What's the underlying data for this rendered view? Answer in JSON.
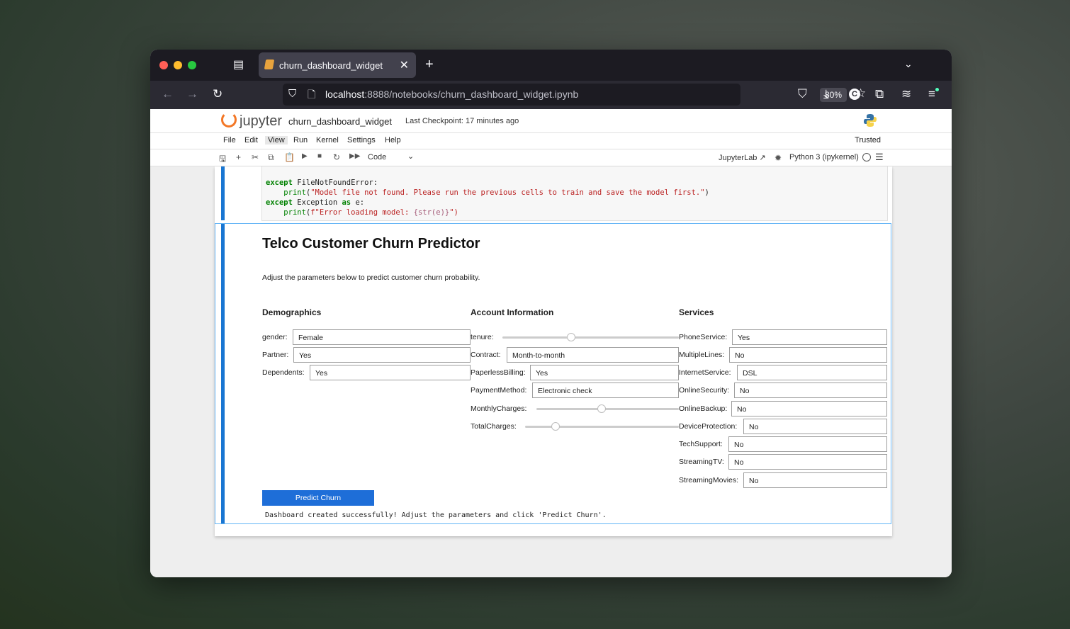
{
  "browser": {
    "tab_title": "churn_dashboard_widget",
    "url_host": "localhost",
    "url_rest": ":8888/notebooks/churn_dashboard_widget.ipynb",
    "zoom": "80%"
  },
  "jupyter": {
    "logo_text": "jupyter",
    "notebook_name": "churn_dashboard_widget",
    "checkpoint": "Last Checkpoint: 17 minutes ago",
    "menu": [
      "File",
      "Edit",
      "View",
      "Run",
      "Kernel",
      "Settings",
      "Help"
    ],
    "trusted": "Trusted",
    "cell_type": "Code",
    "jupyterlab_link": "JupyterLab",
    "kernel": "Python 3 (ipykernel)"
  },
  "code_lines": {
    "l1_kw": "except",
    "l1_rest": " FileNotFoundError:",
    "l2_fn": "print",
    "l2_str": "\"Model file not found. Please run the previous cells to train and save the model first.\"",
    "l3_kw": "except",
    "l3_mid": " Exception ",
    "l3_as": "as",
    "l3_rest": " e:",
    "l4_fn": "print",
    "l4_str": "f\"Error loading model: ",
    "l4_expr": "{str(e)}",
    "l4_end": "\")"
  },
  "dashboard": {
    "title": "Telco Customer Churn Predictor",
    "description": "Adjust the parameters below to predict customer churn probability.",
    "sections": {
      "demographics": "Demographics",
      "account": "Account Information",
      "services": "Services"
    },
    "demographics": {
      "gender": {
        "label": "gender:",
        "value": "Female"
      },
      "partner": {
        "label": "Partner:",
        "value": "Yes"
      },
      "dependents": {
        "label": "Dependents:",
        "value": "Yes"
      }
    },
    "account": {
      "tenure": {
        "label": "tenure:",
        "position": 0.39
      },
      "contract": {
        "label": "Contract:",
        "value": "Month-to-month"
      },
      "paperless": {
        "label": "PaperlessBilling:",
        "value": "Yes"
      },
      "payment": {
        "label": "PaymentMethod:",
        "value": "Electronic check"
      },
      "monthly": {
        "label": "MonthlyCharges:",
        "position": 0.46
      },
      "total": {
        "label": "TotalCharges:",
        "position": 0.2
      }
    },
    "services": {
      "phone": {
        "label": "PhoneService:",
        "value": "Yes"
      },
      "multiple": {
        "label": "MultipleLines:",
        "value": "No"
      },
      "internet": {
        "label": "InternetService:",
        "value": "DSL"
      },
      "security": {
        "label": "OnlineSecurity:",
        "value": "No"
      },
      "backup": {
        "label": "OnlineBackup:",
        "value": "No"
      },
      "protection": {
        "label": "DeviceProtection:",
        "value": "No"
      },
      "techsupport": {
        "label": "TechSupport:",
        "value": "No"
      },
      "tv": {
        "label": "StreamingTV:",
        "value": "No"
      },
      "movies": {
        "label": "StreamingMovies:",
        "value": "No"
      }
    },
    "predict_button": "Predict Churn",
    "output": "Dashboard created successfully! Adjust the parameters and click 'Predict Churn'."
  },
  "colors": {
    "accent": "#1e6ed8",
    "cell_bar": "#1976d2",
    "jupyter_orange": "#f37726"
  }
}
